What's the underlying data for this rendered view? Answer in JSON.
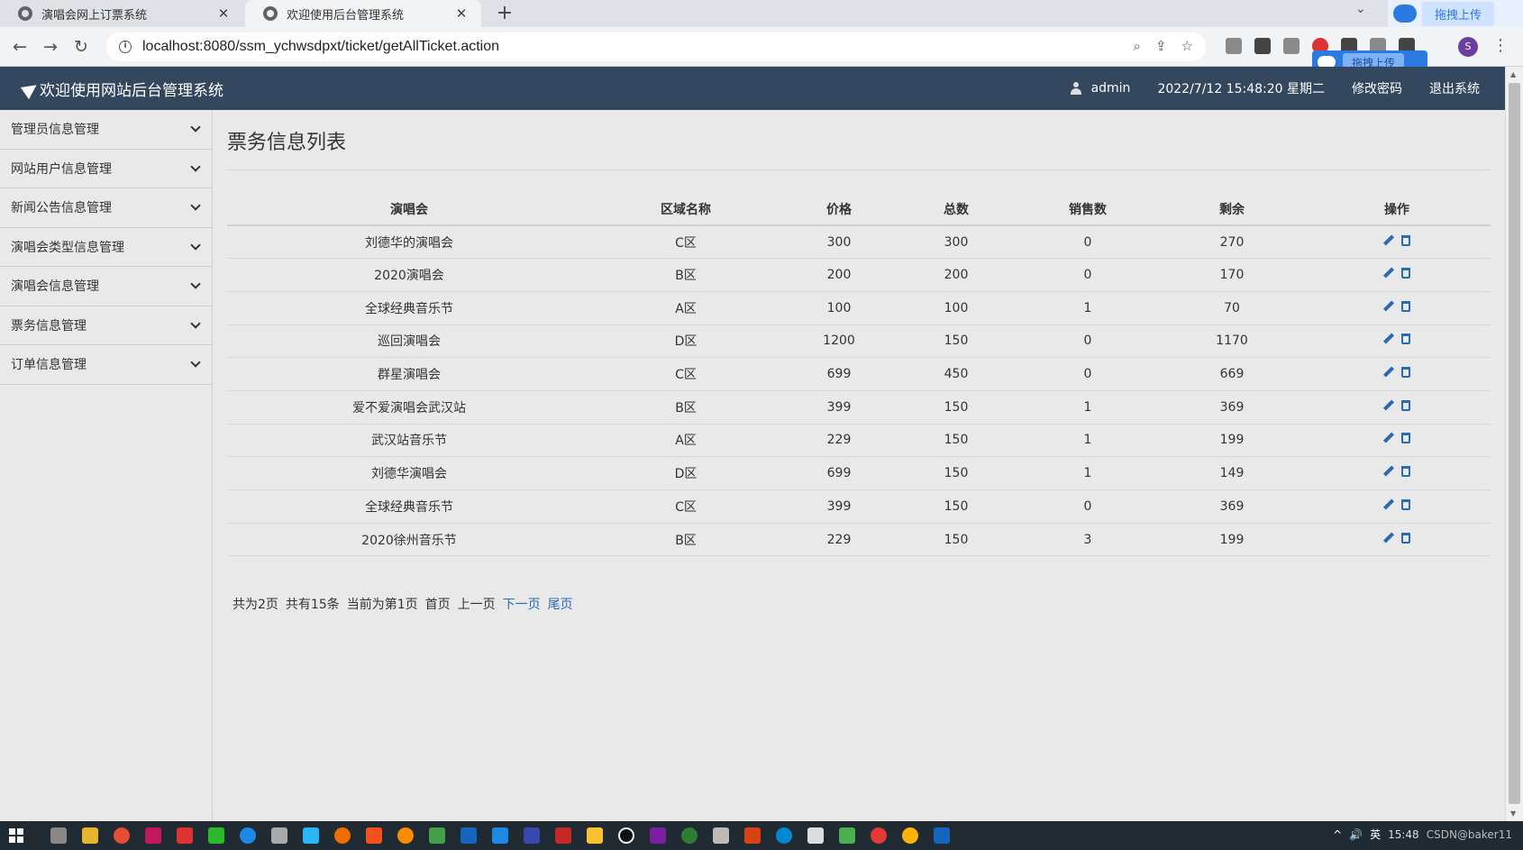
{
  "browser": {
    "tabs": [
      {
        "title": "演唱会网上订票系统",
        "active": false
      },
      {
        "title": "欢迎使用后台管理系统",
        "active": true
      }
    ],
    "close_glyph": "✕",
    "newtab_glyph": "+",
    "url": "localhost:8080/ssm_ychwsdpxt/ticket/getAllTicket.action",
    "cloud_upload_label": "拖拽上传",
    "cloud_upload_label_float": "拖拽上传",
    "profile_letter": "S"
  },
  "header": {
    "brand": "欢迎使用网站后台管理系统",
    "user": "admin",
    "datetime": "2022/7/12 15:48:20 星期二",
    "change_password": "修改密码",
    "logout": "退出系统"
  },
  "sidebar": {
    "items": [
      {
        "label": "管理员信息管理"
      },
      {
        "label": "网站用户信息管理"
      },
      {
        "label": "新闻公告信息管理"
      },
      {
        "label": "演唱会类型信息管理"
      },
      {
        "label": "演唱会信息管理"
      },
      {
        "label": "票务信息管理"
      },
      {
        "label": "订单信息管理"
      }
    ]
  },
  "main": {
    "title": "票务信息列表",
    "columns": [
      "演唱会",
      "区域名称",
      "价格",
      "总数",
      "销售数",
      "剩余",
      "操作"
    ],
    "rows": [
      [
        "刘德华的演唱会",
        "C区",
        "300",
        "300",
        "0",
        "270"
      ],
      [
        "2020演唱会",
        "B区",
        "200",
        "200",
        "0",
        "170"
      ],
      [
        "全球经典音乐节",
        "A区",
        "100",
        "100",
        "1",
        "70"
      ],
      [
        "巡回演唱会",
        "D区",
        "1200",
        "150",
        "0",
        "1170"
      ],
      [
        "群星演唱会",
        "C区",
        "699",
        "450",
        "0",
        "669"
      ],
      [
        "爱不爱演唱会武汉站",
        "B区",
        "399",
        "150",
        "1",
        "369"
      ],
      [
        "武汉站音乐节",
        "A区",
        "229",
        "150",
        "1",
        "199"
      ],
      [
        "刘德华演唱会",
        "D区",
        "699",
        "150",
        "1",
        "149"
      ],
      [
        "全球经典音乐节",
        "C区",
        "399",
        "150",
        "0",
        "369"
      ],
      [
        "2020徐州音乐节",
        "B区",
        "229",
        "150",
        "3",
        "199"
      ]
    ],
    "pager": {
      "total_pages": "共为2页",
      "total_items": "共有15条",
      "current": "当前为第1页",
      "first": "首页",
      "prev": "上一页",
      "next": "下一页",
      "last": "尾页"
    }
  },
  "taskbar": {
    "ime": "英",
    "clock": "15:48",
    "watermark": "CSDN@baker11"
  },
  "colors": {
    "header_bg": "#33475f",
    "link": "#2a6ab5",
    "page_bg": "#e9e9e9"
  }
}
